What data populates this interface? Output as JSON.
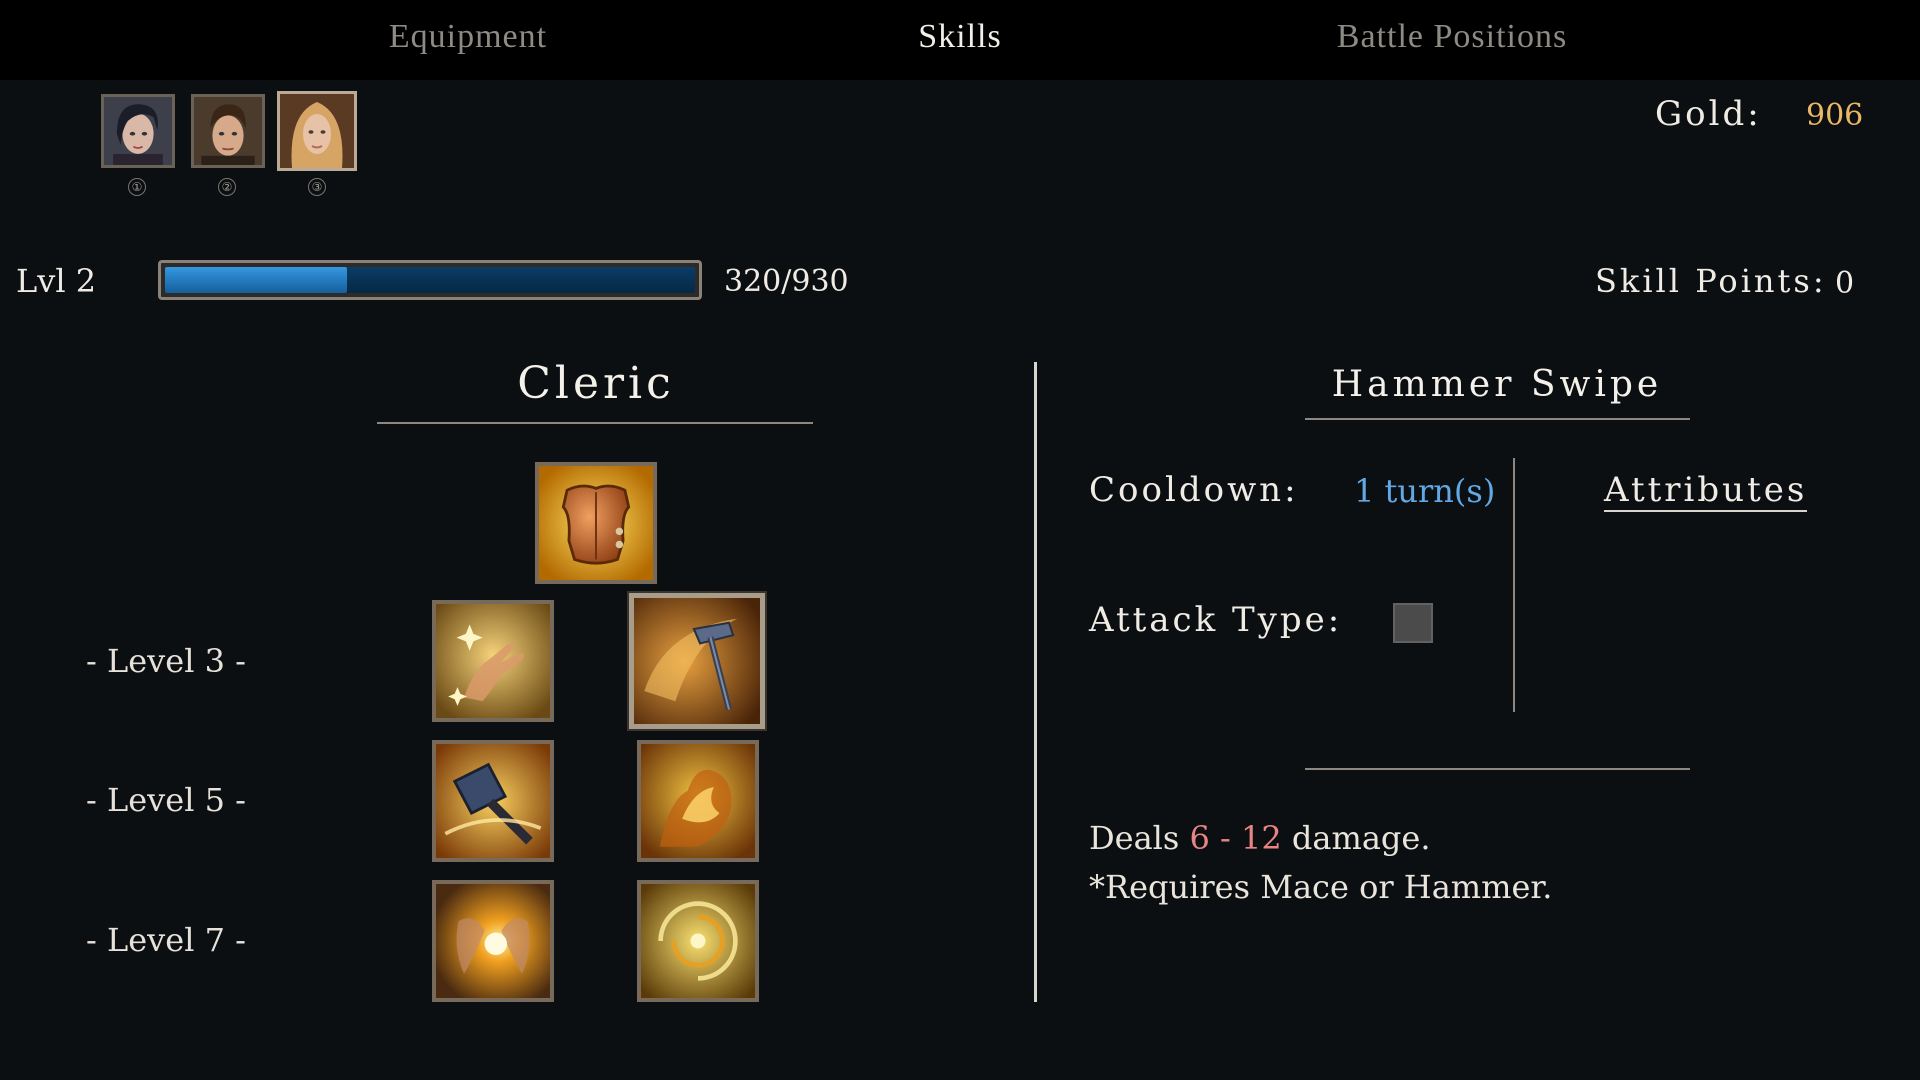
{
  "tabs": [
    {
      "label": "Equipment",
      "active": false
    },
    {
      "label": "Skills",
      "active": true
    },
    {
      "label": "Battle Positions",
      "active": false
    }
  ],
  "party": [
    {
      "slot": "①",
      "selected": false
    },
    {
      "slot": "②",
      "selected": false
    },
    {
      "slot": "③",
      "selected": true
    }
  ],
  "gold": {
    "label": "Gold:",
    "value": "906"
  },
  "level": {
    "label": "Lvl 2",
    "xp_text": "320/930",
    "xp_fraction": 0.344
  },
  "skill_points": {
    "label": "Skill Points:",
    "value": "0"
  },
  "class_name": "Cleric",
  "skill_tree": {
    "level_labels": [
      "- Level 3 -",
      "- Level 5 -",
      "- Level 7 -"
    ],
    "skills": [
      {
        "icon": "breastplate-icon",
        "tier": "base",
        "selected": false
      },
      {
        "icon": "healing-hand-icon",
        "tier": "level-3",
        "selected": false
      },
      {
        "icon": "hammer-swipe-icon",
        "tier": "level-3",
        "selected": true
      },
      {
        "icon": "hammer-strike-icon",
        "tier": "level-5",
        "selected": false
      },
      {
        "icon": "flame-beast-icon",
        "tier": "level-5",
        "selected": false
      },
      {
        "icon": "holy-light-icon",
        "tier": "level-7",
        "selected": false
      },
      {
        "icon": "vortex-icon",
        "tier": "level-7",
        "selected": false
      }
    ]
  },
  "skill_detail": {
    "name": "Hammer Swipe",
    "cooldown_label": "Cooldown:",
    "cooldown_value": "1 turn(s)",
    "attack_type_label": "Attack Type:",
    "attributes_link": "Attributes",
    "desc_prefix": "Deals ",
    "damage": "6 - 12",
    "desc_suffix": " damage.",
    "requirement": "*Requires Mace or Hammer."
  },
  "colors": {
    "gold_value": "#e9b765",
    "cooldown_value": "#61a8e5",
    "damage": "#e88484",
    "xp_fill": "#3597e0"
  }
}
